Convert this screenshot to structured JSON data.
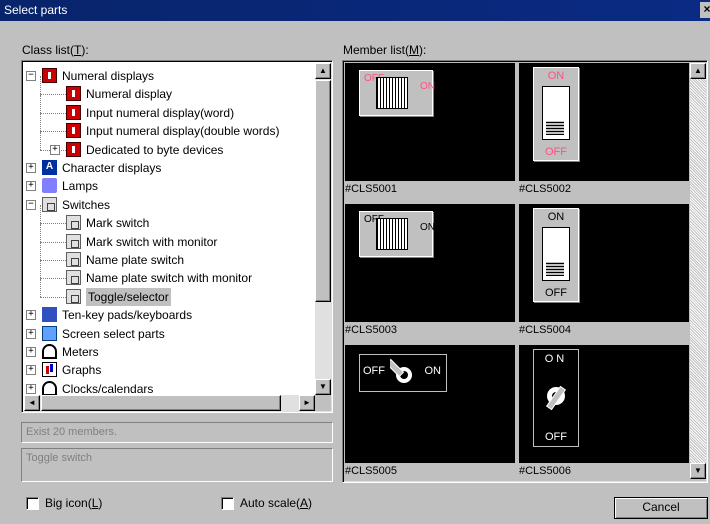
{
  "window": {
    "title": "Select parts",
    "close_glyph": "×"
  },
  "class_list": {
    "label_pre": "Class list(",
    "label_key": "T",
    "label_post": "):",
    "items": [
      {
        "label": "Numeral displays",
        "icon": "numeral-icon",
        "level": 0,
        "expander": "−"
      },
      {
        "label": "Numeral display",
        "icon": "numeral-icon",
        "level": 1
      },
      {
        "label": "Input numeral display(word)",
        "icon": "numeral-icon",
        "level": 1
      },
      {
        "label": "Input numeral display(double words)",
        "icon": "numeral-icon",
        "level": 1
      },
      {
        "label": "Dedicated to byte devices",
        "icon": "numeral-icon",
        "level": 1,
        "expander": "+"
      },
      {
        "label": "Character displays",
        "icon": "character-icon",
        "level": 0,
        "expander": "+"
      },
      {
        "label": "Lamps",
        "icon": "lamp-icon",
        "level": 0,
        "expander": "+"
      },
      {
        "label": "Switches",
        "icon": "switch-icon",
        "level": 0,
        "expander": "−"
      },
      {
        "label": "Mark switch",
        "icon": "switch-icon",
        "level": 1
      },
      {
        "label": "Mark switch with monitor",
        "icon": "switch-icon",
        "level": 1
      },
      {
        "label": "Name plate switch",
        "icon": "switch-icon",
        "level": 1
      },
      {
        "label": "Name plate switch with monitor",
        "icon": "switch-icon",
        "level": 1
      },
      {
        "label": "Toggle/selector",
        "icon": "switch-icon",
        "level": 1,
        "selected": true
      },
      {
        "label": "Ten-key pads/keyboards",
        "icon": "keypad-icon",
        "level": 0,
        "expander": "+"
      },
      {
        "label": "Screen select parts",
        "icon": "screen-icon",
        "level": 0,
        "expander": "+"
      },
      {
        "label": "Meters",
        "icon": "meter-icon",
        "level": 0,
        "expander": "+"
      },
      {
        "label": "Graphs",
        "icon": "graph-icon",
        "level": 0,
        "expander": "+"
      },
      {
        "label": "Clocks/calendars",
        "icon": "clock-icon",
        "level": 0,
        "expander": "+"
      }
    ]
  },
  "members_count": "Exist 20 members.",
  "description": "Toggle switch",
  "member_list": {
    "label_pre": "Member list(",
    "label_key": "M",
    "label_post": "):",
    "items": [
      {
        "id": "#CLS5001",
        "on": "ON",
        "off": "OFF"
      },
      {
        "id": "#CLS5002",
        "on": "ON",
        "off": "OFF"
      },
      {
        "id": "#CLS5003",
        "on": "ON",
        "off": "OFF"
      },
      {
        "id": "#CLS5004",
        "on": "ON",
        "off": "OFF"
      },
      {
        "id": "#CLS5005",
        "on": "ON",
        "off": "OFF"
      },
      {
        "id": "#CLS5006",
        "on": "ON",
        "off": "OFF"
      }
    ]
  },
  "options": {
    "big_icon_pre": "Big icon(",
    "big_icon_key": "L",
    "big_icon_post": ")",
    "auto_scale_pre": "Auto scale(",
    "auto_scale_key": "A",
    "auto_scale_post": ")"
  },
  "cancel_label": "Cancel",
  "scroll": {
    "up": "▲",
    "down": "▼",
    "left": "◄",
    "right": "►"
  },
  "colors": {
    "title_bar": "#0a2a84",
    "numeral_icon": "#cc0000",
    "switch_text_pink": "#ff6090"
  }
}
